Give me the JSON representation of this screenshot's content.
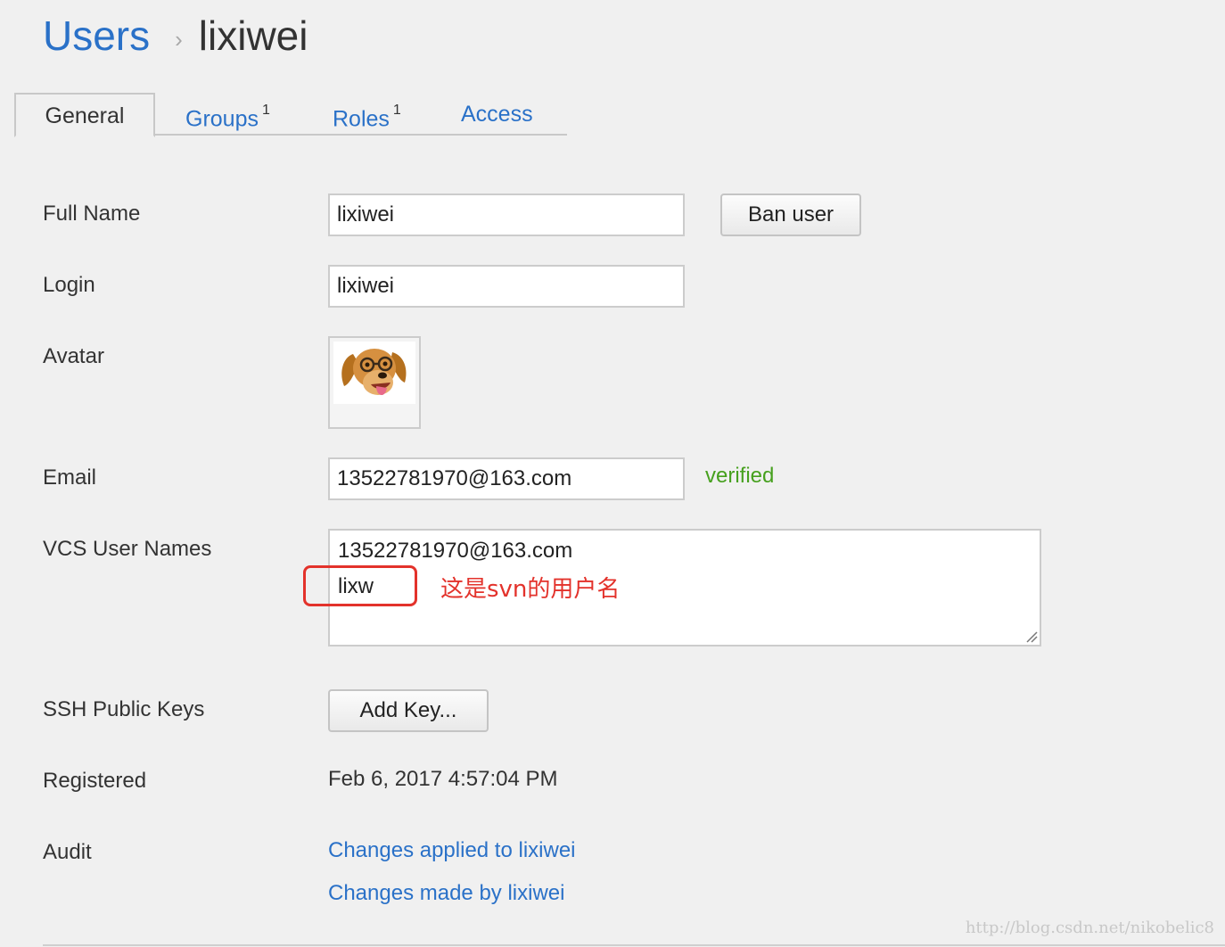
{
  "breadcrumb": {
    "root": "Users",
    "separator": "›",
    "current": "lixiwei"
  },
  "tabs": [
    {
      "label": "General",
      "active": true,
      "count": ""
    },
    {
      "label": "Groups",
      "active": false,
      "count": "1"
    },
    {
      "label": "Roles",
      "active": false,
      "count": "1"
    },
    {
      "label": "Access",
      "active": false,
      "count": ""
    }
  ],
  "form": {
    "full_name": {
      "label": "Full Name",
      "value": "lixiwei"
    },
    "ban_button": "Ban user",
    "login": {
      "label": "Login",
      "value": "lixiwei"
    },
    "avatar": {
      "label": "Avatar"
    },
    "email": {
      "label": "Email",
      "value": "13522781970@163.com",
      "status": "verified"
    },
    "vcs_user_names": {
      "label": "VCS User Names",
      "lines": [
        "13522781970@163.com",
        "lixw"
      ]
    },
    "ssh_keys": {
      "label": "SSH Public Keys",
      "button": "Add Key..."
    },
    "registered": {
      "label": "Registered",
      "value": "Feb 6, 2017 4:57:04 PM"
    },
    "audit": {
      "label": "Audit",
      "links": [
        "Changes applied to lixiwei",
        "Changes made by lixiwei"
      ]
    }
  },
  "annotation": {
    "text": "这是svn的用户名",
    "color": "#e3322b"
  },
  "watermark": "http://blog.csdn.net/nikobelic8",
  "colors": {
    "link": "#2a71c8",
    "verified": "#46a01e",
    "background": "#f0f0f0"
  }
}
